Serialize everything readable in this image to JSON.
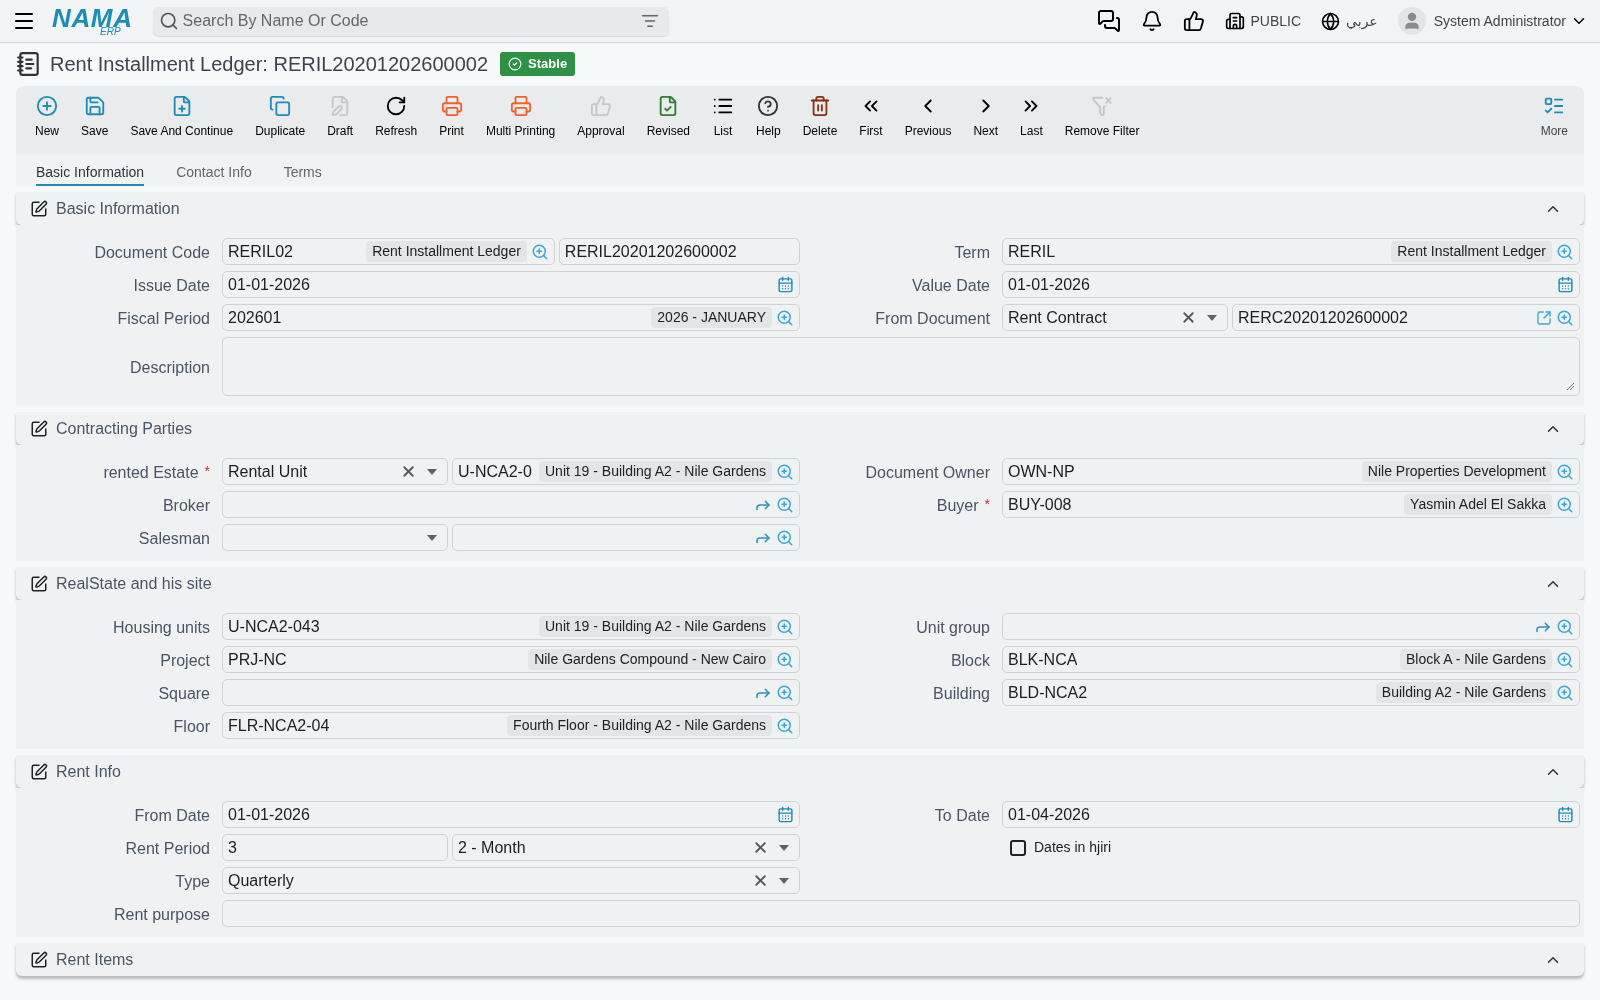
{
  "logo": {
    "name": "NAMA",
    "sub": "ERP"
  },
  "search": {
    "placeholder": "Search By Name Or Code"
  },
  "header": {
    "branch": "PUBLIC",
    "language": "عربي",
    "user": "System Administrator"
  },
  "title": {
    "text": "Rent Installment Ledger: RERIL20201202600002",
    "status": "Stable"
  },
  "toolbar": [
    {
      "kind": "new",
      "label": "New",
      "disabled": false
    },
    {
      "kind": "save",
      "label": "Save",
      "disabled": false
    },
    {
      "kind": "save-continue",
      "label": "Save And Continue",
      "disabled": false
    },
    {
      "kind": "duplicate",
      "label": "Duplicate",
      "disabled": false
    },
    {
      "kind": "draft",
      "label": "Draft",
      "disabled": true
    },
    {
      "kind": "refresh",
      "label": "Refresh",
      "disabled": false
    },
    {
      "kind": "print",
      "label": "Print",
      "disabled": false
    },
    {
      "kind": "multi-print",
      "label": "Multi Printing",
      "disabled": false
    },
    {
      "kind": "approval",
      "label": "Approval",
      "disabled": true
    },
    {
      "kind": "revised",
      "label": "Revised",
      "disabled": false
    },
    {
      "kind": "list",
      "label": "List",
      "disabled": false
    },
    {
      "kind": "help",
      "label": "Help",
      "disabled": false
    },
    {
      "kind": "delete",
      "label": "Delete",
      "disabled": false
    },
    {
      "kind": "first",
      "label": "First",
      "disabled": false
    },
    {
      "kind": "previous",
      "label": "Previous",
      "disabled": false
    },
    {
      "kind": "next",
      "label": "Next",
      "disabled": false
    },
    {
      "kind": "last",
      "label": "Last",
      "disabled": false
    },
    {
      "kind": "remove-filter",
      "label": "Remove Filter",
      "disabled": true
    }
  ],
  "more": {
    "label": "More"
  },
  "tabs": [
    {
      "label": "Basic Information",
      "selected": true
    },
    {
      "label": "Contact Info",
      "selected": false
    },
    {
      "label": "Terms",
      "selected": false
    }
  ],
  "sections": [
    {
      "title": "Basic Information",
      "expanded": true,
      "rows": [
        {
          "left": {
            "label": "Document Code",
            "parts": [
              {
                "kind": "lookup",
                "value": "RERIL02",
                "description": "Rent Installment Ledger"
              },
              {
                "kind": "text",
                "value": "RERIL20201202600002"
              }
            ]
          },
          "right": {
            "label": "Term",
            "parts": [
              {
                "kind": "lookup",
                "value": "RERIL",
                "description": "Rent Installment Ledger"
              }
            ]
          }
        },
        {
          "left": {
            "label": "Issue Date",
            "parts": [
              {
                "kind": "date",
                "value": "01-01-2026"
              }
            ]
          },
          "right": {
            "label": "Value Date",
            "parts": [
              {
                "kind": "date",
                "value": "01-01-2026"
              }
            ]
          }
        },
        {
          "left": {
            "label": "Fiscal Period",
            "parts": [
              {
                "kind": "lookup",
                "value": "202601",
                "description": "2026 - JANUARY"
              }
            ]
          },
          "right": {
            "label": "From Document",
            "parts": [
              {
                "kind": "select",
                "value": "Rent Contract"
              },
              {
                "kind": "doc-lookup",
                "value": "RERC20201202600002"
              }
            ]
          }
        },
        {
          "full": {
            "label": "Description",
            "parts": [
              {
                "kind": "textarea"
              }
            ]
          }
        }
      ]
    },
    {
      "title": "Contracting Parties",
      "expanded": true,
      "rows": [
        {
          "left": {
            "label": "rented Estate",
            "marker": "*",
            "parts": [
              {
                "kind": "select",
                "value": "Rental Unit"
              },
              {
                "kind": "lookup",
                "value": "U-NCA2-0",
                "description": "Unit 19 - Building A2 - Nile Gardens"
              }
            ]
          },
          "right": {
            "label": "Document Owner",
            "parts": [
              {
                "kind": "lookup",
                "value": "OWN-NP",
                "description": "Nile Properties Development"
              }
            ]
          }
        },
        {
          "left": {
            "label": "Broker",
            "parts": [
              {
                "kind": "lookup"
              }
            ]
          },
          "right": {
            "label": "Buyer",
            "marker": "*",
            "parts": [
              {
                "kind": "lookup",
                "value": "BUY-008",
                "description": "Yasmin Adel El Sakka"
              }
            ]
          }
        },
        {
          "left": {
            "label": "Salesman",
            "parts": [
              {
                "kind": "select"
              },
              {
                "kind": "lookup"
              }
            ]
          }
        }
      ]
    },
    {
      "title": "RealState and his site",
      "expanded": true,
      "rows": [
        {
          "left": {
            "label": "Housing units",
            "parts": [
              {
                "kind": "lookup",
                "value": "U-NCA2-043",
                "description": "Unit 19 - Building A2 - Nile Gardens"
              }
            ]
          },
          "right": {
            "label": "Unit group",
            "parts": [
              {
                "kind": "lookup"
              }
            ]
          }
        },
        {
          "left": {
            "label": "Project",
            "parts": [
              {
                "kind": "lookup",
                "value": "PRJ-NC",
                "description": "Nile Gardens Compound - New Cairo"
              }
            ]
          },
          "right": {
            "label": "Block",
            "parts": [
              {
                "kind": "lookup",
                "value": "BLK-NCA",
                "description": "Block A - Nile Gardens"
              }
            ]
          }
        },
        {
          "left": {
            "label": "Square",
            "parts": [
              {
                "kind": "lookup"
              }
            ]
          },
          "right": {
            "label": "Building",
            "parts": [
              {
                "kind": "lookup",
                "value": "BLD-NCA2",
                "description": "Building A2 - Nile Gardens"
              }
            ]
          }
        },
        {
          "left": {
            "label": "Floor",
            "parts": [
              {
                "kind": "lookup",
                "value": "FLR-NCA2-04",
                "description": "Fourth Floor - Building A2 - Nile Gardens"
              }
            ]
          }
        }
      ]
    },
    {
      "title": "Rent Info",
      "expanded": true,
      "rows": [
        {
          "left": {
            "label": "From Date",
            "parts": [
              {
                "kind": "date",
                "value": "01-01-2026"
              }
            ]
          },
          "right": {
            "label": "To Date",
            "parts": [
              {
                "kind": "date",
                "value": "01-04-2026"
              }
            ]
          }
        },
        {
          "left": {
            "label": "Rent Period",
            "parts": [
              {
                "kind": "text",
                "value": "3"
              },
              {
                "kind": "select",
                "value": "2 - Month"
              }
            ]
          },
          "right": {
            "parts": [
              {
                "kind": "checkbox",
                "label": "Dates in hjiri",
                "checked": false
              }
            ]
          }
        },
        {
          "left": {
            "label": "Type",
            "parts": [
              {
                "kind": "select",
                "value": "Quarterly"
              }
            ]
          }
        },
        {
          "full": {
            "label": "Rent purpose",
            "parts": [
              {
                "kind": "text"
              }
            ]
          }
        }
      ]
    },
    {
      "title": "Rent Items",
      "expanded": true
    }
  ]
}
